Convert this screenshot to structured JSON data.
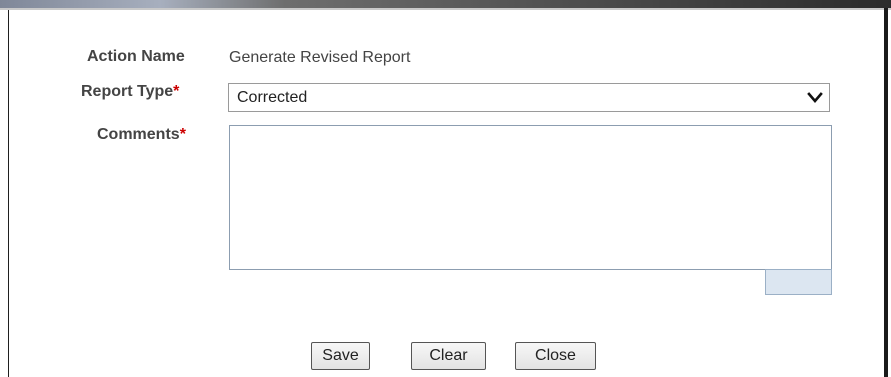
{
  "form": {
    "action_name_label": "Action Name",
    "action_name_value": "Generate Revised Report",
    "report_type_label": "Report Type",
    "report_type_value": "Corrected",
    "comments_label": "Comments",
    "comments_value": "",
    "required_marker": "*"
  },
  "buttons": {
    "save": "Save",
    "clear": "Clear",
    "close": "Close"
  },
  "icons": {
    "dropdown": "chevron-down-icon"
  },
  "colors": {
    "required": "#cc0000",
    "counter_box": "#dce6f1"
  }
}
